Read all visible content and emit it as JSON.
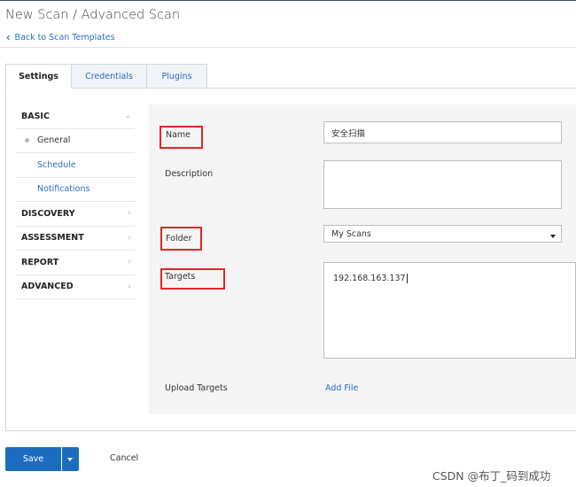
{
  "header": {
    "title": "New Scan / Advanced Scan",
    "back_link": "Back to Scan Templates"
  },
  "tabs": [
    {
      "label": "Settings",
      "active": true
    },
    {
      "label": "Credentials",
      "active": false
    },
    {
      "label": "Plugins",
      "active": false
    }
  ],
  "sidebar": {
    "items": [
      {
        "label": "BASIC",
        "type": "section",
        "expanded": true
      },
      {
        "label": "General",
        "type": "sub",
        "selected": true
      },
      {
        "label": "Schedule",
        "type": "sub"
      },
      {
        "label": "Notifications",
        "type": "sub"
      },
      {
        "label": "DISCOVERY",
        "type": "section"
      },
      {
        "label": "ASSESSMENT",
        "type": "section"
      },
      {
        "label": "REPORT",
        "type": "section"
      },
      {
        "label": "ADVANCED",
        "type": "section"
      }
    ]
  },
  "form": {
    "name_label": "Name",
    "name_value": "安全扫描",
    "description_label": "Description",
    "description_value": "",
    "folder_label": "Folder",
    "folder_value": "My Scans",
    "targets_label": "Targets",
    "targets_value": "192.168.163.137",
    "upload_label": "Upload Targets",
    "add_file": "Add File"
  },
  "footer": {
    "save": "Save",
    "cancel": "Cancel"
  },
  "watermark": "CSDN @布丁_码到成功",
  "colors": {
    "accent": "#1c6dbf",
    "link": "#2a6ebb",
    "highlight": "#e0262b",
    "form_bg": "#f4f4f4"
  },
  "icons": {
    "back": "chevron-left-icon",
    "expand": "chevron-down-icon",
    "collapsed": "chevron-right-icon",
    "dropdown": "caret-down-icon"
  }
}
